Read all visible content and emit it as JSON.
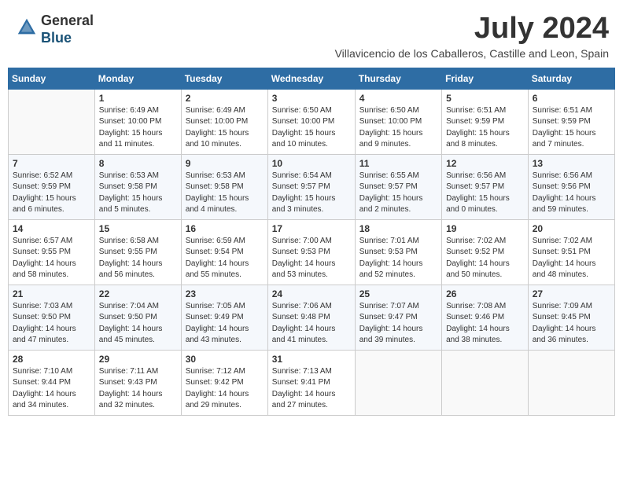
{
  "header": {
    "logo": {
      "line1": "General",
      "line2": "Blue"
    },
    "month": "July 2024",
    "location": "Villavicencio de los Caballeros, Castille and Leon, Spain"
  },
  "weekdays": [
    "Sunday",
    "Monday",
    "Tuesday",
    "Wednesday",
    "Thursday",
    "Friday",
    "Saturday"
  ],
  "weeks": [
    [
      {
        "day": "",
        "info": ""
      },
      {
        "day": "1",
        "info": "Sunrise: 6:49 AM\nSunset: 10:00 PM\nDaylight: 15 hours\nand 11 minutes."
      },
      {
        "day": "2",
        "info": "Sunrise: 6:49 AM\nSunset: 10:00 PM\nDaylight: 15 hours\nand 10 minutes."
      },
      {
        "day": "3",
        "info": "Sunrise: 6:50 AM\nSunset: 10:00 PM\nDaylight: 15 hours\nand 10 minutes."
      },
      {
        "day": "4",
        "info": "Sunrise: 6:50 AM\nSunset: 10:00 PM\nDaylight: 15 hours\nand 9 minutes."
      },
      {
        "day": "5",
        "info": "Sunrise: 6:51 AM\nSunset: 9:59 PM\nDaylight: 15 hours\nand 8 minutes."
      },
      {
        "day": "6",
        "info": "Sunrise: 6:51 AM\nSunset: 9:59 PM\nDaylight: 15 hours\nand 7 minutes."
      }
    ],
    [
      {
        "day": "7",
        "info": "Sunrise: 6:52 AM\nSunset: 9:59 PM\nDaylight: 15 hours\nand 6 minutes."
      },
      {
        "day": "8",
        "info": "Sunrise: 6:53 AM\nSunset: 9:58 PM\nDaylight: 15 hours\nand 5 minutes."
      },
      {
        "day": "9",
        "info": "Sunrise: 6:53 AM\nSunset: 9:58 PM\nDaylight: 15 hours\nand 4 minutes."
      },
      {
        "day": "10",
        "info": "Sunrise: 6:54 AM\nSunset: 9:57 PM\nDaylight: 15 hours\nand 3 minutes."
      },
      {
        "day": "11",
        "info": "Sunrise: 6:55 AM\nSunset: 9:57 PM\nDaylight: 15 hours\nand 2 minutes."
      },
      {
        "day": "12",
        "info": "Sunrise: 6:56 AM\nSunset: 9:57 PM\nDaylight: 15 hours\nand 0 minutes."
      },
      {
        "day": "13",
        "info": "Sunrise: 6:56 AM\nSunset: 9:56 PM\nDaylight: 14 hours\nand 59 minutes."
      }
    ],
    [
      {
        "day": "14",
        "info": "Sunrise: 6:57 AM\nSunset: 9:55 PM\nDaylight: 14 hours\nand 58 minutes."
      },
      {
        "day": "15",
        "info": "Sunrise: 6:58 AM\nSunset: 9:55 PM\nDaylight: 14 hours\nand 56 minutes."
      },
      {
        "day": "16",
        "info": "Sunrise: 6:59 AM\nSunset: 9:54 PM\nDaylight: 14 hours\nand 55 minutes."
      },
      {
        "day": "17",
        "info": "Sunrise: 7:00 AM\nSunset: 9:53 PM\nDaylight: 14 hours\nand 53 minutes."
      },
      {
        "day": "18",
        "info": "Sunrise: 7:01 AM\nSunset: 9:53 PM\nDaylight: 14 hours\nand 52 minutes."
      },
      {
        "day": "19",
        "info": "Sunrise: 7:02 AM\nSunset: 9:52 PM\nDaylight: 14 hours\nand 50 minutes."
      },
      {
        "day": "20",
        "info": "Sunrise: 7:02 AM\nSunset: 9:51 PM\nDaylight: 14 hours\nand 48 minutes."
      }
    ],
    [
      {
        "day": "21",
        "info": "Sunrise: 7:03 AM\nSunset: 9:50 PM\nDaylight: 14 hours\nand 47 minutes."
      },
      {
        "day": "22",
        "info": "Sunrise: 7:04 AM\nSunset: 9:50 PM\nDaylight: 14 hours\nand 45 minutes."
      },
      {
        "day": "23",
        "info": "Sunrise: 7:05 AM\nSunset: 9:49 PM\nDaylight: 14 hours\nand 43 minutes."
      },
      {
        "day": "24",
        "info": "Sunrise: 7:06 AM\nSunset: 9:48 PM\nDaylight: 14 hours\nand 41 minutes."
      },
      {
        "day": "25",
        "info": "Sunrise: 7:07 AM\nSunset: 9:47 PM\nDaylight: 14 hours\nand 39 minutes."
      },
      {
        "day": "26",
        "info": "Sunrise: 7:08 AM\nSunset: 9:46 PM\nDaylight: 14 hours\nand 38 minutes."
      },
      {
        "day": "27",
        "info": "Sunrise: 7:09 AM\nSunset: 9:45 PM\nDaylight: 14 hours\nand 36 minutes."
      }
    ],
    [
      {
        "day": "28",
        "info": "Sunrise: 7:10 AM\nSunset: 9:44 PM\nDaylight: 14 hours\nand 34 minutes."
      },
      {
        "day": "29",
        "info": "Sunrise: 7:11 AM\nSunset: 9:43 PM\nDaylight: 14 hours\nand 32 minutes."
      },
      {
        "day": "30",
        "info": "Sunrise: 7:12 AM\nSunset: 9:42 PM\nDaylight: 14 hours\nand 29 minutes."
      },
      {
        "day": "31",
        "info": "Sunrise: 7:13 AM\nSunset: 9:41 PM\nDaylight: 14 hours\nand 27 minutes."
      },
      {
        "day": "",
        "info": ""
      },
      {
        "day": "",
        "info": ""
      },
      {
        "day": "",
        "info": ""
      }
    ]
  ]
}
